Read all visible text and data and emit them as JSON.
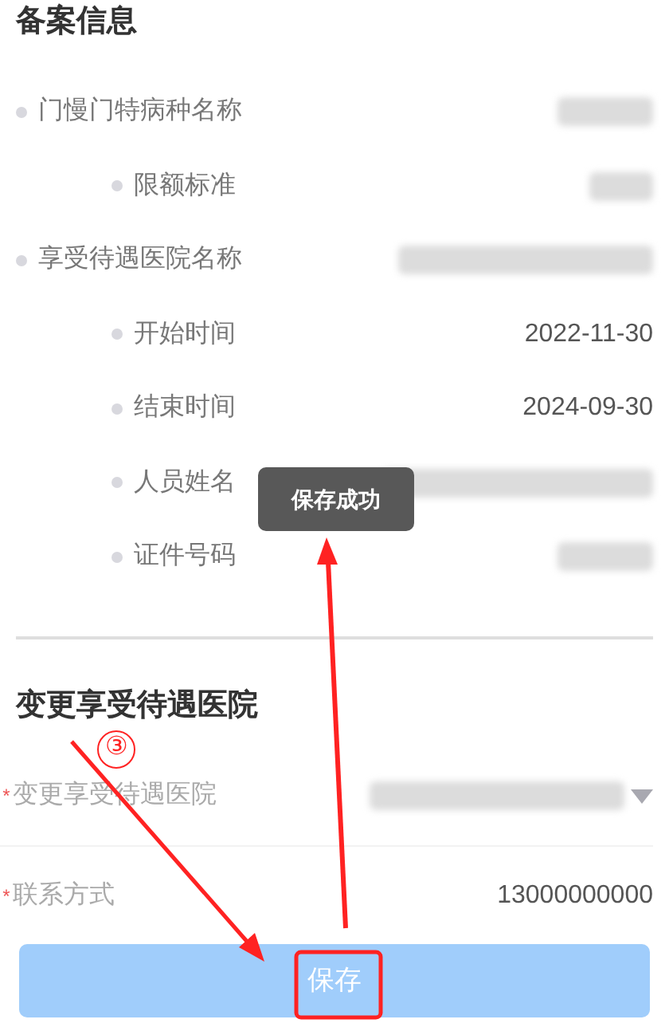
{
  "filing_info": {
    "title": "备案信息",
    "rows": [
      {
        "label": "门慢门特病种名称",
        "value": {
          "kind": "redacted"
        },
        "children": [
          {
            "label": "限额标准",
            "value": {
              "kind": "redacted"
            }
          }
        ]
      },
      {
        "label": "享受待遇医院名称",
        "value": {
          "kind": "redacted"
        },
        "children": [
          {
            "label": "开始时间",
            "value": {
              "kind": "text",
              "text": "2022-11-30"
            }
          },
          {
            "label": "结束时间",
            "value": {
              "kind": "text",
              "text": "2024-09-30"
            }
          },
          {
            "label": "人员姓名",
            "value": {
              "kind": "redacted"
            }
          },
          {
            "label": "证件号码",
            "value": {
              "kind": "redacted"
            }
          }
        ]
      }
    ]
  },
  "toast": {
    "text": "保存成功"
  },
  "change_hospital": {
    "title": "变更享受待遇医院",
    "fields": [
      {
        "kind": "select",
        "label": "变更享受待遇医院",
        "required_mark": "*",
        "value": {
          "kind": "redacted"
        }
      },
      {
        "kind": "text",
        "label": "联系方式",
        "required_mark": "*",
        "value": {
          "kind": "text",
          "text": "13000000000"
        }
      }
    ]
  },
  "save_button": {
    "label": "保存"
  },
  "annotation": {
    "step": "③"
  }
}
